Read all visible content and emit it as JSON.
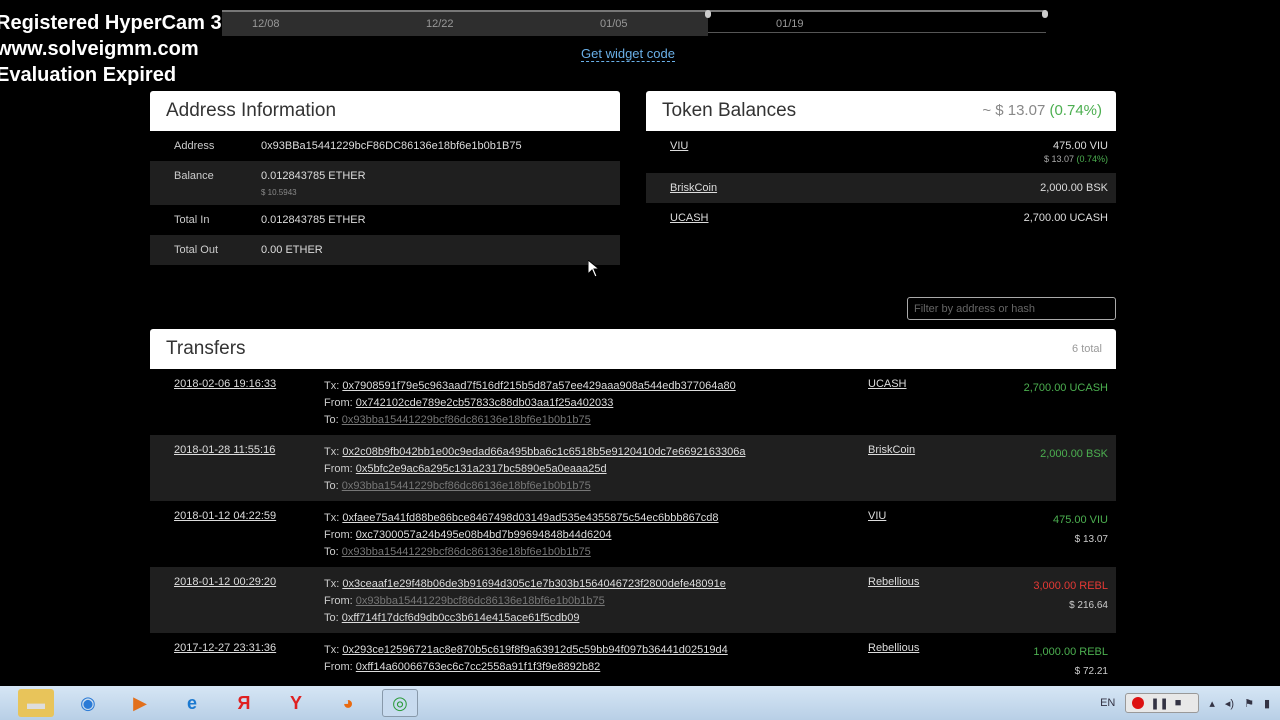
{
  "watermark": [
    "Registered HyperCam 3",
    "www.solveigmm.com",
    "Evaluation Expired"
  ],
  "timeline": {
    "labels": [
      "12/08",
      "12/22",
      "01/05",
      "01/19"
    ]
  },
  "widget_link": "Get widget code",
  "address_info": {
    "title": "Address Information",
    "rows": [
      {
        "label": "Address",
        "value": "0x93BBa15441229bcF86DC86136e18bf6e1b0b1B75",
        "sub": ""
      },
      {
        "label": "Balance",
        "value": "0.012843785 ETHER",
        "sub": "$ 10.5943"
      },
      {
        "label": "Total In",
        "value": "0.012843785 ETHER",
        "sub": ""
      },
      {
        "label": "Total Out",
        "value": "0.00 ETHER",
        "sub": ""
      }
    ]
  },
  "token_balances": {
    "title": "Token Balances",
    "total_usd": "~ $ 13.07",
    "total_pct": "(0.74%)",
    "items": [
      {
        "name": "VIU",
        "amount": "475.00 VIU",
        "usd": "$ 13.07",
        "pct": "(0.74%)"
      },
      {
        "name": "BriskCoin",
        "amount": "2,000.00 BSK",
        "usd": "",
        "pct": ""
      },
      {
        "name": "UCASH",
        "amount": "2,700.00 UCASH",
        "usd": "",
        "pct": ""
      }
    ]
  },
  "filter": {
    "placeholder": "Filter by address or hash"
  },
  "transfers": {
    "title": "Transfers",
    "count": "6 total",
    "tx_label": "Tx:",
    "from_label": "From:",
    "to_label": "To:",
    "rows": [
      {
        "date": "2018-02-06 19:16:33",
        "tx": "0x7908591f79e5c963aad7f516df215b5d87a57ee429aaa908a544edb377064a80",
        "from": "0x742102cde789e2cb57833c88db03aa1f25a402033",
        "to": "0x93bba15441229bcf86dc86136e18bf6e1b0b1b75",
        "token": "UCASH",
        "amount": "2,700.00 UCASH",
        "usd": "",
        "direction": "in"
      },
      {
        "date": "2018-01-28 11:55:16",
        "tx": "0x2c08b9fb042bb1e00c9edad66a495bba6c1c6518b5e9120410dc7e6692163306a",
        "from": "0x5bfc2e9ac6a295c131a2317bc5890e5a0eaaa25d",
        "to": "0x93bba15441229bcf86dc86136e18bf6e1b0b1b75",
        "token": "BriskCoin",
        "amount": "2,000.00 BSK",
        "usd": "",
        "direction": "in"
      },
      {
        "date": "2018-01-12 04:22:59",
        "tx": "0xfaee75a41fd88be86bce8467498d03149ad535e4355875c54ec6bbb867cd8",
        "from": "0xc7300057a24b495e08b4bd7b99694848b44d6204",
        "to": "0x93bba15441229bcf86dc86136e18bf6e1b0b1b75",
        "token": "VIU",
        "amount": "475.00 VIU",
        "usd": "$ 13.07",
        "direction": "in"
      },
      {
        "date": "2018-01-12 00:29:20",
        "tx": "0x3ceaaf1e29f48b06de3b91694d305c1e7b303b1564046723f2800defe48091e",
        "from": "0x93bba15441229bcf86dc86136e18bf6e1b0b1b75",
        "to": "0xff714f17dcf6d9db0cc3b614e415ace61f5cdb09",
        "token": "Rebellious",
        "amount": "3,000.00 REBL",
        "usd": "$ 216.64",
        "direction": "out"
      },
      {
        "date": "2017-12-27 23:31:36",
        "tx": "0x293ce12596721ac8e870b5c619f8f9a63912d5c59bb94f097b36441d02519d4",
        "from": "0xff14a60066763ec6c7cc2558a91f1f3f9e8892b82",
        "to": "",
        "token": "Rebellious",
        "amount": "1,000.00 REBL",
        "usd": "$ 72.21",
        "direction": "in"
      }
    ]
  },
  "taskbar": {
    "apps": [
      "explorer",
      "shield",
      "media",
      "ie",
      "yandex-browser",
      "yandex",
      "firefox",
      "chrome"
    ],
    "tray_lang": "EN"
  }
}
